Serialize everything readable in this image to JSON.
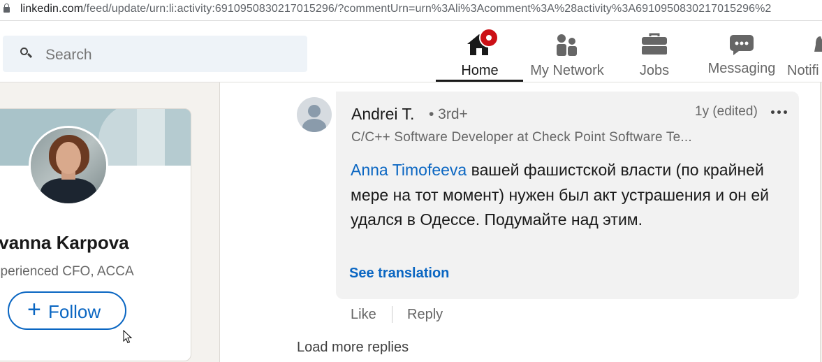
{
  "browser": {
    "url_host": "linkedin.com",
    "url_path": "/feed/update/urn:li:activity:6910950830217015296/?commentUrn=urn%3Ali%3Acomment%3A%28activity%3A6910950830217015296%2"
  },
  "search": {
    "placeholder": "Search"
  },
  "nav": {
    "items": [
      {
        "label": "Home",
        "icon": "home-icon",
        "active": true
      },
      {
        "label": "My Network",
        "icon": "network-icon"
      },
      {
        "label": "Jobs",
        "icon": "briefcase-icon"
      },
      {
        "label": "Messaging",
        "icon": "chat-icon"
      },
      {
        "label": "Notifi",
        "icon": "bell-icon"
      }
    ]
  },
  "profile": {
    "name": "Ivanna Karpova",
    "headline": "xperienced CFO, ACCA",
    "follow_icon": "+",
    "follow_label": "Follow"
  },
  "comment": {
    "author": "Andrei T.",
    "degree": "• 3rd+",
    "time": "1y (edited)",
    "subtitle": "C/C++ Software Developer at Check Point Software Te...",
    "mention": "Anna Timofeeva",
    "text": " вашей фашистской власти (по крайней мере на тот момент) нужен был акт устрашения и он ей удался в Одессе. Подумайте над этим.",
    "see_translation": "See translation",
    "like": "Like",
    "reply": "Reply"
  },
  "load_more": "Load more replies",
  "colors": {
    "brand_blue": "#0a66c2",
    "notification_red": "#cc1016",
    "page_bg": "#f4f2ee"
  }
}
